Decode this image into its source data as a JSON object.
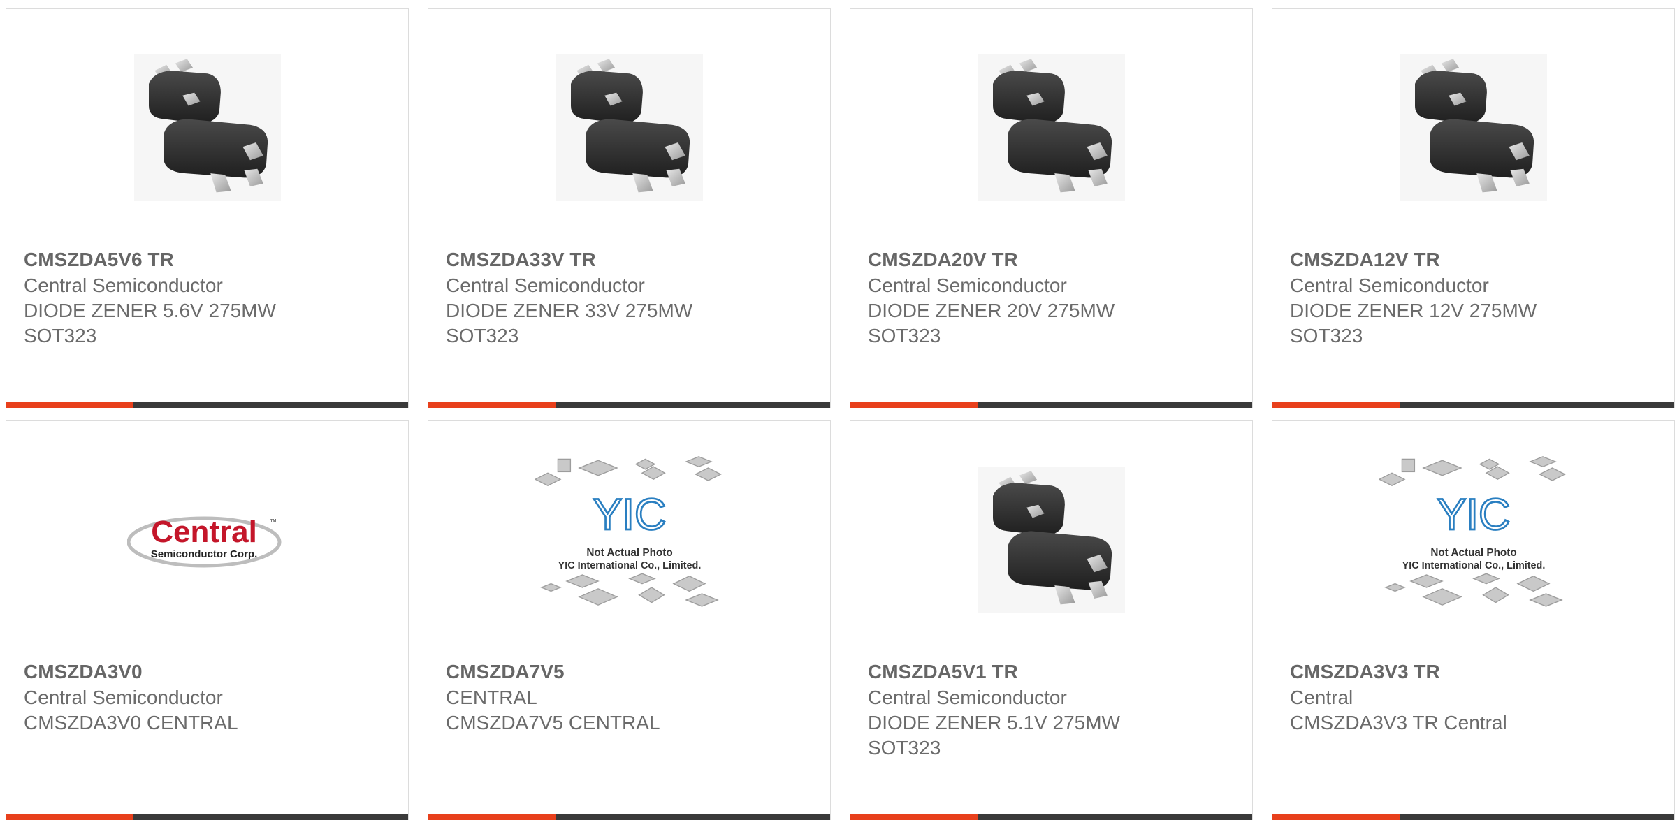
{
  "accent_color": "#e8401c",
  "bar_color": "#3a3a3a",
  "products": [
    {
      "part": "CMSZDA5V6 TR",
      "maker": "Central Semiconductor",
      "desc1": "DIODE ZENER 5.6V 275MW",
      "desc2": "SOT323",
      "image": "sot323-package-photo"
    },
    {
      "part": "CMSZDA33V TR",
      "maker": "Central Semiconductor",
      "desc1": "DIODE ZENER 33V 275MW",
      "desc2": "SOT323",
      "image": "sot323-package-photo"
    },
    {
      "part": "CMSZDA20V TR",
      "maker": "Central Semiconductor",
      "desc1": "DIODE ZENER 20V 275MW",
      "desc2": "SOT323",
      "image": "sot323-package-photo"
    },
    {
      "part": "CMSZDA12V TR",
      "maker": "Central Semiconductor",
      "desc1": "DIODE ZENER 12V 275MW",
      "desc2": "SOT323",
      "image": "sot323-package-photo"
    },
    {
      "part": "CMSZDA3V0",
      "maker": "Central Semiconductor",
      "desc1": "CMSZDA3V0 CENTRAL",
      "desc2": "",
      "image": "central-logo",
      "logo": {
        "word": "Central",
        "tm": "™",
        "sub": "Semiconductor Corp."
      }
    },
    {
      "part": "CMSZDA7V5",
      "maker": "CENTRAL",
      "desc1": "CMSZDA7V5 CENTRAL",
      "desc2": "",
      "image": "yic-placeholder",
      "placeholder": {
        "brand": "YIC",
        "line1": "Not Actual Photo",
        "line2": "YIC International Co., Limited."
      }
    },
    {
      "part": "CMSZDA5V1 TR",
      "maker": "Central Semiconductor",
      "desc1": "DIODE ZENER 5.1V 275MW",
      "desc2": "SOT323",
      "image": "sot323-package-photo"
    },
    {
      "part": "CMSZDA3V3 TR",
      "maker": "Central",
      "desc1": "CMSZDA3V3 TR Central",
      "desc2": "",
      "image": "yic-placeholder",
      "placeholder": {
        "brand": "YIC",
        "line1": "Not Actual Photo",
        "line2": "YIC International Co., Limited."
      }
    }
  ]
}
